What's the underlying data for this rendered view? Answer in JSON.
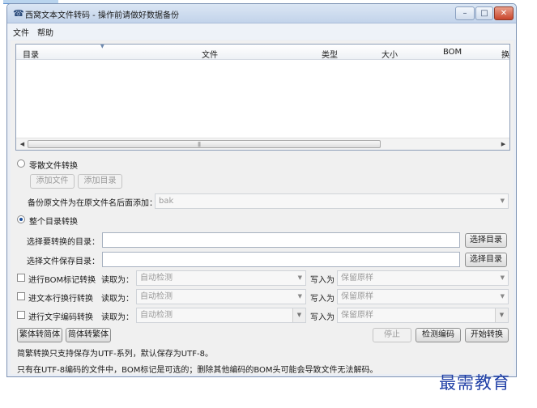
{
  "window": {
    "title": "西窝文本文件转码 - 操作前请做好数据备份",
    "icon": "app-icon",
    "controls": {
      "minimize": "–",
      "maximize": "□",
      "close": "✕"
    }
  },
  "menu": {
    "file": "文件",
    "help": "帮助"
  },
  "table": {
    "columns": [
      "目录",
      "文件",
      "类型",
      "大小",
      "BOM",
      "换"
    ],
    "rows": []
  },
  "scatter": {
    "radio_label": "零散文件转换",
    "add_file": "添加文件",
    "add_dir": "添加目录",
    "backup_label": "备份原文件为在原文件名后面添加：",
    "backup_value": "bak"
  },
  "whole": {
    "radio_label": "整个目录转换",
    "src_label": "选择要转换的目录：",
    "src_value": "",
    "src_button": "选择目录",
    "dst_label": "选择文件保存目录：",
    "dst_value": "",
    "dst_button": "选择目录"
  },
  "options": [
    {
      "label": "进行BOM标记转换",
      "read_label": "读取为：",
      "read_value": "自动检测",
      "write_label": "写入为",
      "write_value": "保留原样"
    },
    {
      "label": "进文本行换行转换",
      "read_label": "读取为：",
      "read_value": "自动检测",
      "write_label": "写入为",
      "write_value": "保留原样"
    },
    {
      "label": "进行文字编码转换",
      "read_label": "读取为：",
      "read_value": "自动检测",
      "write_label": "写入为",
      "write_value": "保留原样"
    }
  ],
  "actions": {
    "trad_to_simp": "繁体转简体",
    "simp_to_trad": "简体转繁体",
    "stop": "停止",
    "detect": "检测编码",
    "start": "开始转换"
  },
  "notes": {
    "line1": "简繁转换只支持保存为UTF-系列，默认保存为UTF-8。",
    "line2": "只有在UTF-8编码的文件中，BOM标记是可选的；删除其他编码的BOM头可能会导致文件无法解码。"
  },
  "watermark": "最需教育"
}
